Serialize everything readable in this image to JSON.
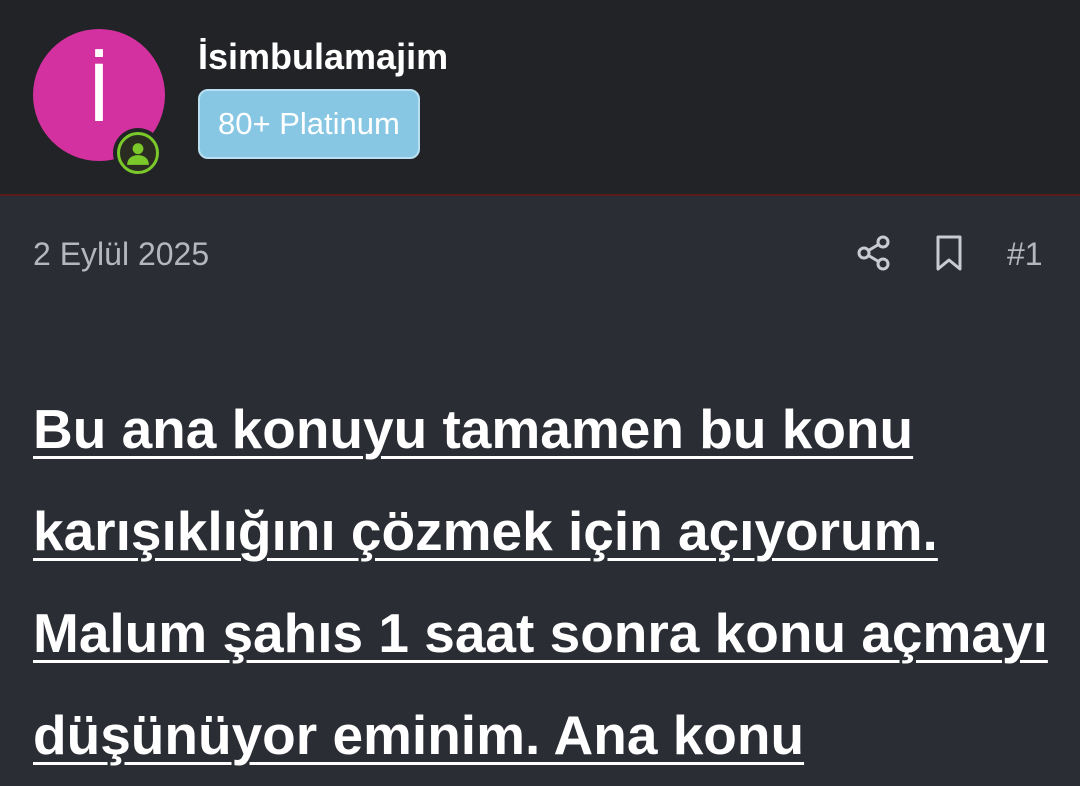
{
  "user": {
    "avatar_letter": "İ",
    "avatar_color": "#d331a0",
    "status_color": "#7bc82a",
    "status_icon": "person-icon",
    "username": "İsimbulamajim",
    "badge": "80+ Platinum",
    "badge_color": "#87c7e3"
  },
  "post": {
    "date": "2 Eylül 2025",
    "number": "#1",
    "actions": [
      "share-icon",
      "bookmark-icon"
    ],
    "lines": [
      "Bu ana konuyu tamamen bu konu",
      "karışıklığını çözmek için açıyorum.",
      "Malum şahıs 1 saat sonra konu açmayı",
      "düşünüyor eminim. Ana konu"
    ]
  }
}
